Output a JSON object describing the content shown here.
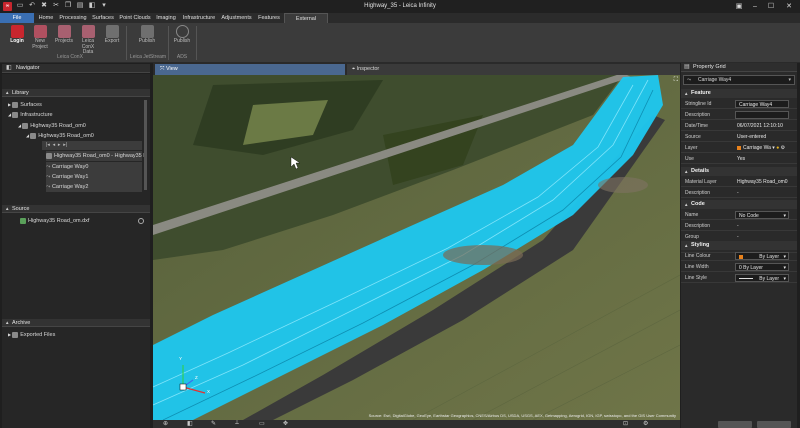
{
  "window": {
    "title": "Highway_35 - Leica Infinity"
  },
  "menu": {
    "tabs": [
      {
        "label": "File"
      },
      {
        "label": "Home"
      },
      {
        "label": "Processing"
      },
      {
        "label": "Surfaces"
      },
      {
        "label": "Point Clouds"
      },
      {
        "label": "Imaging"
      },
      {
        "label": "Infrastructure"
      },
      {
        "label": "Adjustments"
      },
      {
        "label": "Features"
      },
      {
        "label": "External Services"
      }
    ]
  },
  "ribbon": {
    "buttons": [
      {
        "label": "Login"
      },
      {
        "label": "New Project"
      },
      {
        "label": "Projects"
      },
      {
        "label": "Leica ConX Data"
      },
      {
        "label": "Export"
      },
      {
        "label": "Publish"
      },
      {
        "label": "Publish"
      }
    ],
    "groups": [
      {
        "label": "Leica ConX"
      },
      {
        "label": "Leica JetStream"
      },
      {
        "label": "ADS"
      }
    ]
  },
  "navigator": {
    "title": "Navigator",
    "library": {
      "title": "Library",
      "items": [
        {
          "label": "Surfaces"
        },
        {
          "label": "Infrastructure"
        },
        {
          "label": "Highway35 Road_om0"
        },
        {
          "label": "Highway35 Road_om0"
        },
        {
          "label": "Highway35 Road_om0 - Highway35 R"
        },
        {
          "label": "Carriage Way0"
        },
        {
          "label": "Carriage Way1"
        },
        {
          "label": "Carriage Way2"
        }
      ]
    },
    "source": {
      "title": "Source",
      "items": [
        {
          "label": "Highway35 Road_om.dxf"
        }
      ]
    },
    "archive": {
      "title": "Archive",
      "items": [
        {
          "label": "Exported Files"
        }
      ]
    }
  },
  "view": {
    "tabs": [
      {
        "label": "View"
      },
      {
        "label": "Inspector"
      }
    ],
    "attribution": "Source: Esri, DigitalGlobe, GeoEye, Earthstar Geographics, CNES/Airbus DS, USDA, USGS, AEX, Getmapping, Aerogrid, IGN, IGP, swisstopo, and the GIS User Community",
    "axes": {
      "x": "X",
      "y": "Y",
      "z": "Z"
    }
  },
  "property_grid": {
    "title": "Property Grid",
    "selector": "Carriage Way4",
    "sections": [
      {
        "title": "Feature",
        "rows": [
          {
            "key": "Stringline Id",
            "value": "Carriage Way4"
          },
          {
            "key": "Description",
            "value": ""
          },
          {
            "key": "Date/Time",
            "value": "06/07/2021 12:10:10"
          },
          {
            "key": "Source",
            "value": "User-entered"
          },
          {
            "key": "Layer",
            "value": "Carriage Wa"
          },
          {
            "key": "Use",
            "value": "Yes"
          }
        ]
      },
      {
        "title": "Details",
        "rows": [
          {
            "key": "Material Layer",
            "value": "Highway35 Road_om0"
          },
          {
            "key": "Description",
            "value": "-"
          }
        ]
      },
      {
        "title": "Code",
        "rows": [
          {
            "key": "Name",
            "value": "No Code"
          },
          {
            "key": "Description",
            "value": "-"
          },
          {
            "key": "Group",
            "value": "-"
          },
          {
            "key": "Attributes",
            "value": "-"
          }
        ]
      },
      {
        "title": "Styling",
        "rows": [
          {
            "key": "Line Colour",
            "value": "By Layer"
          },
          {
            "key": "Line Width",
            "value": "0      By Layer"
          },
          {
            "key": "Line Style",
            "value": "By Layer"
          }
        ]
      }
    ]
  },
  "colors": {
    "accent": "#3a6fb3",
    "brand_red": "#c8262e",
    "road_overlay": "#1ec8f0",
    "line_colour_swatch": "#e8821c"
  }
}
